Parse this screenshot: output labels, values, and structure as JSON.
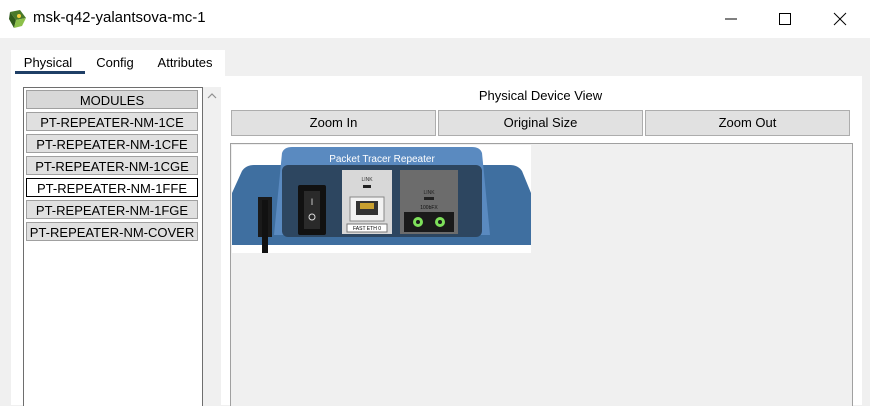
{
  "window": {
    "title": "msk-q42-yalantsova-mc-1"
  },
  "tabs": [
    "Physical",
    "Config",
    "Attributes"
  ],
  "modules": {
    "header": "MODULES",
    "items": [
      "PT-REPEATER-NM-1CE",
      "PT-REPEATER-NM-1CFE",
      "PT-REPEATER-NM-1CGE",
      "PT-REPEATER-NM-1FFE",
      "PT-REPEATER-NM-1FGE",
      "PT-REPEATER-NM-COVER"
    ],
    "selected": "PT-REPEATER-NM-1FFE"
  },
  "device_view": {
    "title": "Physical Device View",
    "zoom_in": "Zoom In",
    "original_size": "Original Size",
    "zoom_out": "Zoom Out",
    "device_label": "Packet Tracer Repeater",
    "port_link_label": "LINK",
    "port_eth_label": "FAST ETH 0",
    "fiber_link_label": "LINK",
    "fiber_label": "100bFX"
  },
  "colors": {
    "tab_underline": "#1f3f66",
    "device_blue": "#4f7fb0",
    "led_green": "#7ee05a"
  }
}
